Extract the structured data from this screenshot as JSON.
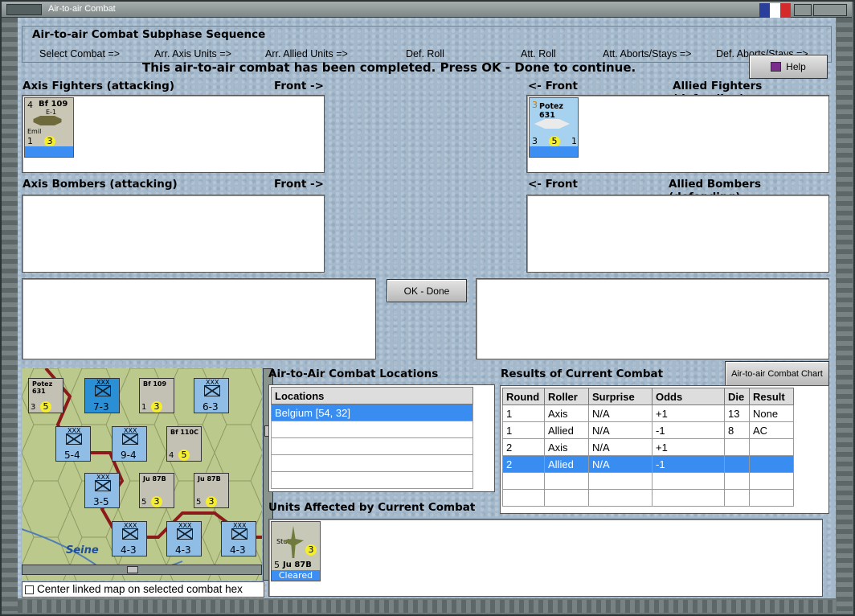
{
  "window": {
    "title": "Air-to-air Combat"
  },
  "sequence": {
    "title": "Air-to-air Combat Subphase Sequence",
    "items": [
      "Select Combat =>",
      "Arr. Axis Units =>",
      "Arr. Allied Units =>",
      "Def. Roll",
      "Att. Roll",
      "Att. Aborts/Stays =>",
      "Def. Aborts/Stays =>"
    ]
  },
  "message": "This air-to-air combat has been completed.  Press OK - Done to continue.",
  "help_label": "Help",
  "axis_fighters": {
    "label": "Axis Fighters (attacking)",
    "front": "Front ->"
  },
  "allied_fighters": {
    "label": "Allied Fighters (defending)",
    "front": "<- Front"
  },
  "axis_bombers": {
    "label": "Axis Bombers (attacking)",
    "front": "Front ->"
  },
  "allied_bombers": {
    "label": "Allied Bombers (defending)",
    "front": "<- Front"
  },
  "axis_fighter_counter": {
    "name": "Bf 109",
    "sub": "E-1",
    "variant": "Emil",
    "top": "4",
    "bl": "1",
    "val": "3"
  },
  "allied_fighter_counter": {
    "name": "Potez 631",
    "top": "3",
    "bl": "3",
    "val": "5",
    "br": "1"
  },
  "ok_label": "OK - Done",
  "locations": {
    "title": "Air-to-Air Combat Locations",
    "header": "Locations",
    "rows": [
      "Belgium [54, 32]"
    ]
  },
  "results": {
    "title": "Results of Current Combat",
    "chart_button": "Air-to-air Combat Chart",
    "headers": [
      "Round",
      "Roller",
      "Surprise",
      "Odds",
      "Die",
      "Result"
    ],
    "rows": [
      [
        "1",
        "Axis",
        "N/A",
        "+1",
        "13",
        "None"
      ],
      [
        "1",
        "Allied",
        "N/A",
        "-1",
        "8",
        "AC"
      ],
      [
        "2",
        "Axis",
        "N/A",
        "+1",
        "",
        ""
      ],
      [
        "2",
        "Allied",
        "N/A",
        "-1",
        "",
        ""
      ]
    ]
  },
  "affected": {
    "title": "Units Affected by Current Combat",
    "unit": {
      "name": "Stuka",
      "type": "Ju 87B",
      "top": "5",
      "val": "3",
      "status": "Cleared"
    }
  },
  "map": {
    "river": "Seine",
    "counters": [
      {
        "t": "Potez 631",
        "a": "3",
        "b": "5",
        "c": "1"
      },
      {
        "t": "7-3",
        "u": "XXX"
      },
      {
        "t": "Bf 109",
        "a": "1",
        "b": "3"
      },
      {
        "t": "6-3",
        "u": "XXX"
      },
      {
        "t": "5-4",
        "u": "XXX"
      },
      {
        "t": "9-4",
        "u": "XXX"
      },
      {
        "t": "Bf 110C",
        "a": "4",
        "b": "5"
      },
      {
        "t": "3-5",
        "u": "XXX"
      },
      {
        "t": "Ju 87B",
        "a": "5",
        "b": "3"
      },
      {
        "t": "Ju 87B",
        "a": "5",
        "b": "3"
      },
      {
        "t": "4-3",
        "u": "XXX"
      },
      {
        "t": "4-3",
        "u": "XXX"
      },
      {
        "t": "4-3",
        "u": "XXX"
      }
    ]
  },
  "center_checkbox": "Center linked map on selected combat hex"
}
